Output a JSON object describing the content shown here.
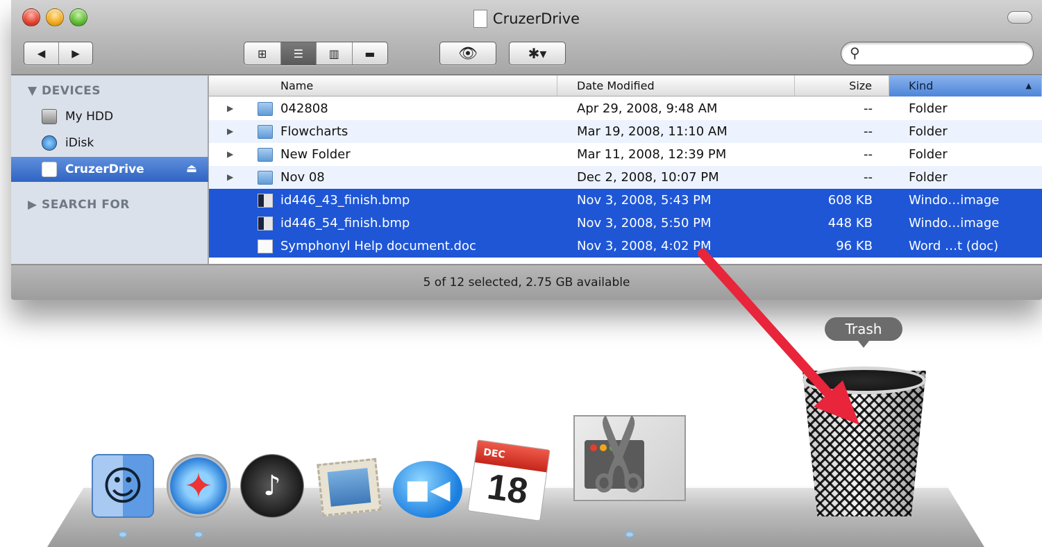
{
  "window": {
    "title": "CruzerDrive",
    "status": "5 of 12 selected, 2.75 GB available"
  },
  "toolbar": {
    "back_icon": "◀",
    "forward_icon": "▶",
    "view_icons": [
      "⊞",
      "☰",
      "▥",
      "▬"
    ],
    "quicklook_icon": "👁",
    "action_icon": "✱▾",
    "search_placeholder": ""
  },
  "sidebar": {
    "devices_label": "▼ DEVICES",
    "search_label": "▶ SEARCH FOR",
    "items": [
      {
        "label": "My HDD",
        "icon": "hard-drive-icon"
      },
      {
        "label": "iDisk",
        "icon": "idisk-icon"
      },
      {
        "label": "CruzerDrive",
        "icon": "usb-drive-icon",
        "eject": "⏏"
      }
    ]
  },
  "columns": {
    "name": "Name",
    "date": "Date Modified",
    "size": "Size",
    "kind": "Kind",
    "sort_arrow": "▲"
  },
  "rows": [
    {
      "disclosure": "▶",
      "name": "042808",
      "date": "Apr 29, 2008, 9:48 AM",
      "size": "--",
      "kind": "Folder"
    },
    {
      "disclosure": "▶",
      "name": "Flowcharts",
      "date": "Mar 19, 2008, 11:10 AM",
      "size": "--",
      "kind": "Folder"
    },
    {
      "disclosure": "▶",
      "name": "New Folder",
      "date": "Mar 11, 2008, 12:39 PM",
      "size": "--",
      "kind": "Folder"
    },
    {
      "disclosure": "▶",
      "name": "Nov 08",
      "date": "Dec 2, 2008, 10:07 PM",
      "size": "--",
      "kind": "Folder"
    },
    {
      "name": "id446_43_finish.bmp",
      "date": "Nov 3, 2008, 5:43 PM",
      "size": "608 KB",
      "kind": "Windo…image"
    },
    {
      "name": "id446_54_finish.bmp",
      "date": "Nov 3, 2008, 5:50 PM",
      "size": "448 KB",
      "kind": "Windo…image"
    },
    {
      "name": "Symphonyl Help document.doc",
      "date": "Nov 3, 2008, 4:02 PM",
      "size": "96 KB",
      "kind": "Word …t (doc)"
    }
  ],
  "dock": {
    "trash_label": "Trash",
    "calendar_month": "DEC",
    "calendar_day": "18",
    "finder_glyph": "☺",
    "safari_glyph": "✦",
    "dashboard_glyph": "♪",
    "ichat_glyph": "■◀",
    "scissors_glyph": "✂"
  },
  "colors": {
    "selection": "#1e56d6",
    "sidebar_selection": "#3a6fcb",
    "arrow": "#e8253a"
  }
}
